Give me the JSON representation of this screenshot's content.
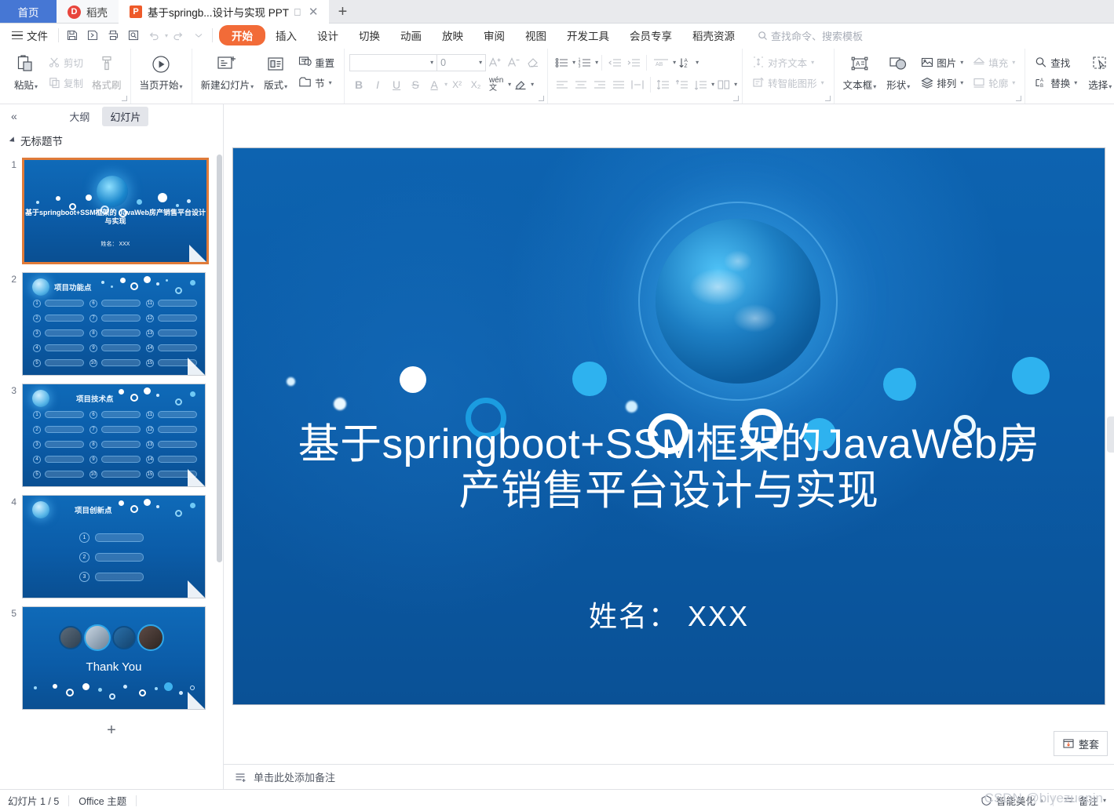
{
  "window": {
    "tabs": [
      {
        "label": "首页",
        "type": "home",
        "icon": "home-tab"
      },
      {
        "label": "稻壳",
        "type": "plain",
        "icon": "daoke-icon"
      },
      {
        "label": "基于springb...设计与实现 PPT",
        "type": "active",
        "icon": "ppt-file-icon"
      }
    ],
    "new_tab_label": "+"
  },
  "menubar": {
    "file_label": "文件",
    "quick_icons": [
      "save-icon",
      "save-as-icon",
      "print-icon",
      "print-preview-icon",
      "undo-icon",
      "redo-icon",
      "customize-qat-icon"
    ],
    "items": [
      {
        "label": "开始",
        "selected": true
      },
      {
        "label": "插入",
        "selected": false
      },
      {
        "label": "设计",
        "selected": false
      },
      {
        "label": "切换",
        "selected": false
      },
      {
        "label": "动画",
        "selected": false
      },
      {
        "label": "放映",
        "selected": false
      },
      {
        "label": "审阅",
        "selected": false
      },
      {
        "label": "视图",
        "selected": false
      },
      {
        "label": "开发工具",
        "selected": false
      },
      {
        "label": "会员专享",
        "selected": false
      },
      {
        "label": "稻壳资源",
        "selected": false
      }
    ],
    "search_placeholder": "查找命令、搜索模板",
    "accent_color": "#f26b38"
  },
  "ribbon": {
    "clipboard": {
      "paste_label": "粘贴",
      "cut_label": "剪切",
      "copy_label": "复制",
      "format_painter_label": "格式刷"
    },
    "presentation": {
      "from_current_label": "当页开始"
    },
    "slides": {
      "new_slide_label": "新建幻灯片",
      "layout_label": "版式",
      "reset_label": "重置",
      "section_label": "节"
    },
    "font": {
      "family_value": "",
      "size_value": "0",
      "grow_label": "A+",
      "shrink_label": "A-",
      "clear_format_label": "清除格式",
      "bold_label": "B",
      "italic_label": "I",
      "underline_label": "U",
      "strike_label": "S",
      "font_color_label": "A",
      "superscript_label": "X²",
      "subscript_label": "X₂",
      "pinyin_label": "wén",
      "highlight_label": "突出显示"
    },
    "paragraph": {
      "bullets_label": "项目符号",
      "numbering_label": "编号",
      "decrease_indent_label": "减少缩进",
      "increase_indent_label": "增加缩进",
      "text_direction_label": "AB",
      "sort_label": "排序",
      "align_left_label": "左对齐",
      "align_center_label": "居中",
      "align_right_label": "右对齐",
      "justify_label": "两端对齐",
      "distribute_label": "分散对齐",
      "line_spacing_label": "行距",
      "space_before_label": "段前",
      "space_after_label": "段后",
      "columns_label": "分栏",
      "align_text_label": "对齐文本",
      "to_smartart_label": "转智能图形"
    },
    "drawing": {
      "textbox_label": "文本框",
      "shape_label": "形状",
      "picture_label": "图片",
      "arrange_label": "排列",
      "fill_label": "填充",
      "outline_label": "轮廓"
    },
    "editing": {
      "find_label": "查找",
      "replace_label": "替换",
      "select_label": "选择"
    }
  },
  "sidebar": {
    "collapse_label": "«",
    "tabs": [
      {
        "label": "大纲",
        "active": false
      },
      {
        "label": "幻灯片",
        "active": true
      }
    ],
    "section_name": "无标题节",
    "add_slide_label": "+",
    "slides": [
      {
        "number": "1",
        "selected": true,
        "kind": "title",
        "title": "基于springboot+SSM框架的 JavaWeb房产销售平台设计与实现",
        "subtitle": "姓名：  XXX"
      },
      {
        "number": "2",
        "selected": false,
        "kind": "list15",
        "heading": "项目功能点"
      },
      {
        "number": "3",
        "selected": false,
        "kind": "list15",
        "heading": "项目技术点"
      },
      {
        "number": "4",
        "selected": false,
        "kind": "list3",
        "heading": "项目创新点"
      },
      {
        "number": "5",
        "selected": false,
        "kind": "thanks",
        "heading": "Thank You"
      }
    ]
  },
  "slide": {
    "title": "基于springboot+SSM框架的JavaWeb房产销售平台设计与实现",
    "subtitle": "姓名：   XXX",
    "background_color": "#0b5ca8",
    "text_color": "#ffffff"
  },
  "notes": {
    "placeholder": "单击此处添加备注",
    "add_icon": "add-notes-icon"
  },
  "bottom_right": {
    "zhengtao_label": "整套",
    "zhengtao_icon": "download-set-icon"
  },
  "status": {
    "slide_counter": "幻灯片 1 / 5",
    "theme": "Office 主题",
    "beautify_label": "智能美化",
    "notes_label": "备注",
    "watermark": "CSDN @biyezuopin"
  }
}
